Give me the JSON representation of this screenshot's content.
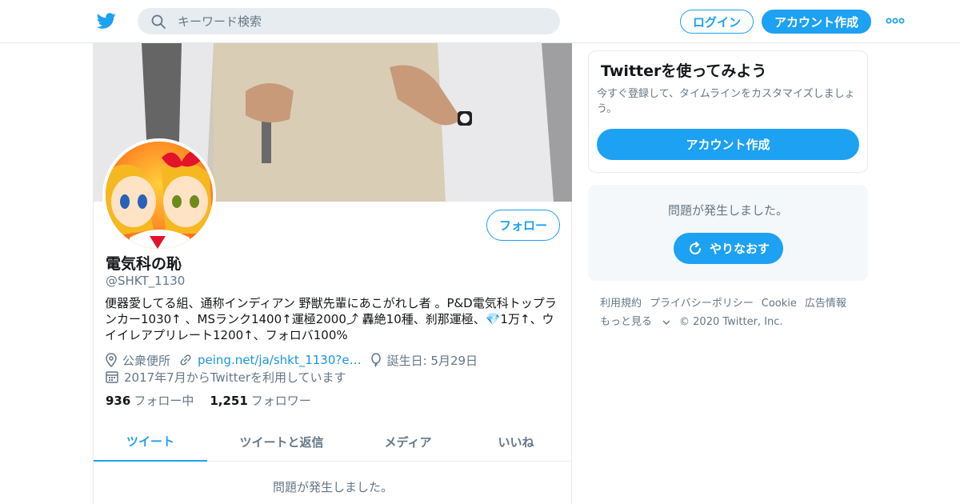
{
  "topbar": {
    "search_placeholder": "キーワード検索",
    "login_label": "ログイン",
    "signup_label": "アカウント作成"
  },
  "profile": {
    "name": "電気科の恥",
    "handle": "@SHKT_1130",
    "follow_label": "フォロー",
    "bio": "便器愛してる組、通称インディアン 野獣先輩にあこがれし者 。P&D電気科トップランカー1030↑ 、MSランク1400↑運極2000⤴ 轟絶10種、刹那運極、💎1万↑、ウイイレアプリレート1200↑、フォロバ100%",
    "location": "公衆便所",
    "website": "peing.net/ja/shkt_1130?e…",
    "birthday": "誕生日: 5月29日",
    "joined": "2017年7月からTwitterを利用しています",
    "following_count": "936",
    "following_label": "フォロー中",
    "followers_count": "1,251",
    "followers_label": "フォロワー"
  },
  "tabs": [
    {
      "label": "ツイート",
      "active": true
    },
    {
      "label": "ツイートと返信",
      "active": false
    },
    {
      "label": "メディア",
      "active": false
    },
    {
      "label": "いいね",
      "active": false
    }
  ],
  "timeline": {
    "error_text": "問題が発生しました。"
  },
  "sidebar": {
    "signup_title": "Twitterを使ってみよう",
    "signup_desc": "今すぐ登録して、タイムラインをカスタマイズしましょう。",
    "signup_button": "アカウント作成",
    "error_text": "問題が発生しました。",
    "retry_label": "やりなおす"
  },
  "footer": {
    "links": [
      "利用規約",
      "プライバシーポリシー",
      "Cookie",
      "広告情報"
    ],
    "more": "もっと見る",
    "copyright": "© 2020 Twitter, Inc."
  },
  "colors": {
    "accent": "#1da1f2",
    "text_secondary": "#657786",
    "border": "#e6ecf0"
  }
}
